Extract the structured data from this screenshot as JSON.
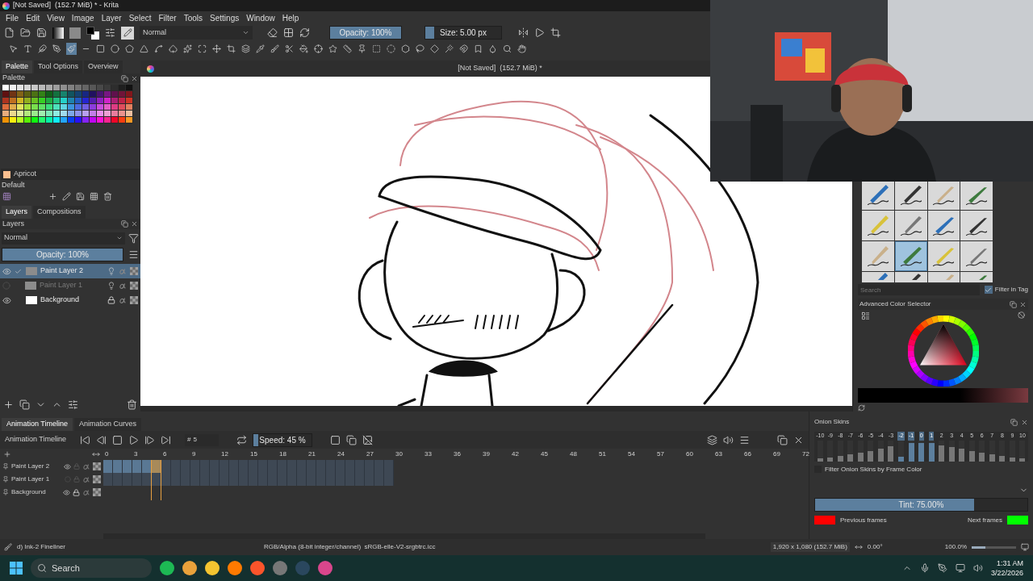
{
  "window": {
    "title": "[Not Saved]  (152.7 MiB) * - Krita"
  },
  "menu": [
    "File",
    "Edit",
    "View",
    "Image",
    "Layer",
    "Select",
    "Filter",
    "Tools",
    "Settings",
    "Window",
    "Help"
  ],
  "toolbar": {
    "blend_mode": "Normal",
    "opacity": {
      "label": "Opacity: 100%",
      "level": 1
    },
    "size": {
      "label": "Size: 5.00 px",
      "level": 0.12
    }
  },
  "tools": [
    {
      "selected": false
    },
    {
      "selected": false
    },
    {
      "selected": false
    },
    {
      "selected": false
    },
    {
      "selected": true
    },
    {
      "selected": false
    },
    {
      "selected": false
    },
    {
      "selected": false
    },
    {
      "selected": false
    },
    {
      "selected": false
    },
    {
      "selected": false
    },
    {
      "selected": false
    },
    {
      "selected": false
    },
    {
      "selected": false
    },
    {
      "selected": false
    },
    {
      "selected": false
    },
    {
      "selected": false
    },
    {
      "selected": false
    },
    {
      "selected": false
    },
    {
      "selected": false
    },
    {
      "selected": false
    },
    {
      "selected": false
    },
    {
      "selected": false
    },
    {
      "selected": false
    },
    {
      "selected": false
    },
    {
      "selected": false
    },
    {
      "selected": false
    },
    {
      "selected": false
    },
    {
      "selected": false
    },
    {
      "selected": false
    },
    {
      "selected": false
    },
    {
      "selected": false
    },
    {
      "selected": false
    },
    {
      "selected": false
    },
    {
      "selected": false
    },
    {
      "selected": false
    }
  ],
  "left_docker": {
    "tabs": [
      {
        "label": "Palette",
        "selected": true
      },
      {
        "label": "Tool Options",
        "selected": false
      },
      {
        "label": "Overview",
        "selected": false
      }
    ],
    "palette": {
      "title": "Palette",
      "current": {
        "name": "Apricot",
        "color": "#fbbf8f"
      },
      "set": "Default"
    },
    "layer_tabs": [
      {
        "label": "Layers",
        "selected": true
      },
      {
        "label": "Compositions",
        "selected": false
      }
    ],
    "layers": {
      "title": "Layers",
      "blend_mode": "Normal",
      "opacity": {
        "label": "Opacity:  100%",
        "level": 1
      },
      "items": [
        {
          "name": "Paint Layer 2",
          "visible": true,
          "selected": true,
          "locked": false
        },
        {
          "name": "Paint Layer 1",
          "visible": false,
          "selected": false,
          "locked": false
        },
        {
          "name": "Background",
          "visible": true,
          "selected": false,
          "locked": true
        }
      ]
    }
  },
  "canvas": {
    "title": "[Not Saved]  (152.7 MiB) *"
  },
  "brush_presets": {
    "items": [
      {
        "selected": false
      },
      {
        "selected": false
      },
      {
        "selected": false
      },
      {
        "selected": false
      },
      {
        "selected": false
      },
      {
        "selected": false
      },
      {
        "selected": false
      },
      {
        "selected": false
      },
      {
        "selected": false
      },
      {
        "selected": true
      },
      {
        "selected": false
      },
      {
        "selected": false
      },
      {
        "selected": false
      },
      {
        "selected": false
      },
      {
        "selected": false
      },
      {
        "selected": false
      }
    ],
    "search": {
      "placeholder": "Search"
    },
    "filter_in_tag": {
      "label": "Filter in Tag",
      "checked": true
    }
  },
  "color_selector": {
    "title": "Advanced Color Selector"
  },
  "timeline": {
    "tabs": [
      {
        "label": "Animation Timeline",
        "selected": true
      },
      {
        "label": "Animation Curves",
        "selected": false
      }
    ],
    "title": "Animation Timeline",
    "frame": {
      "prefix": "#",
      "value": "5"
    },
    "speed": {
      "label": "Speed: 45 %",
      "level": 0.08
    },
    "ruler": [
      "0",
      "3",
      "6",
      "9",
      "12",
      "15",
      "18",
      "21",
      "24",
      "27",
      "30",
      "33",
      "36",
      "39",
      "42",
      "45",
      "48",
      "51",
      "54",
      "57",
      "60",
      "63",
      "66",
      "69",
      "72"
    ],
    "layers": [
      {
        "name": "Paint Layer 2",
        "visible": true,
        "locked": false
      },
      {
        "name": "Paint Layer 1",
        "visible": false,
        "locked": false
      },
      {
        "name": "Background",
        "visible": true,
        "locked": true
      }
    ]
  },
  "onion_skins": {
    "title": "Onion Skins",
    "offsets": [
      {
        "label": "-10",
        "selected": false,
        "level": 0.12
      },
      {
        "label": "-9",
        "selected": false,
        "level": 0.18
      },
      {
        "label": "-8",
        "selected": false,
        "level": 0.25
      },
      {
        "label": "-7",
        "selected": false,
        "level": 0.33
      },
      {
        "label": "-6",
        "selected": false,
        "level": 0.42
      },
      {
        "label": "-5",
        "selected": false,
        "level": 0.5
      },
      {
        "label": "-4",
        "selected": false,
        "level": 0.6
      },
      {
        "label": "-3",
        "selected": false,
        "level": 0.72
      },
      {
        "label": "-2",
        "selected": true,
        "level": 0.2
      },
      {
        "label": "-1",
        "selected": true,
        "level": 0.85
      },
      {
        "label": "0",
        "selected": true,
        "level": 0.85
      },
      {
        "label": "1",
        "selected": true,
        "level": 0.85
      },
      {
        "label": "2",
        "selected": false,
        "level": 0.75
      },
      {
        "label": "3",
        "selected": false,
        "level": 0.68
      },
      {
        "label": "4",
        "selected": false,
        "level": 0.6
      },
      {
        "label": "5",
        "selected": false,
        "level": 0.5
      },
      {
        "label": "6",
        "selected": false,
        "level": 0.42
      },
      {
        "label": "7",
        "selected": false,
        "level": 0.33
      },
      {
        "label": "8",
        "selected": false,
        "level": 0.25
      },
      {
        "label": "9",
        "selected": false,
        "level": 0.18
      },
      {
        "label": "10",
        "selected": false,
        "level": 0.12
      }
    ],
    "filter": {
      "label": "Filter Onion Skins by Frame Color",
      "checked": false
    },
    "tint": {
      "label": "Tint: 75.00%",
      "level": 0.75
    },
    "previous": {
      "label": "Previous frames",
      "color": "#ff0000"
    },
    "next": {
      "label": "Next frames",
      "color": "#00ff00"
    }
  },
  "status_bar": {
    "brush": "d) Ink-2 Fineliner",
    "color_space": "RGB/Alpha (8-bit integer/channel)  sRGB-elle-V2-srgbtrc.icc",
    "image_size": "1,920 x 1,080 (152.7 MiB)",
    "rotation": "0.00°",
    "zoom": "100.0%",
    "zoom_level": {
      "level": 0.3
    }
  },
  "taskbar": {
    "search": {
      "placeholder": "Search"
    },
    "time": "1:31 AM",
    "date": "3/22/2026"
  }
}
